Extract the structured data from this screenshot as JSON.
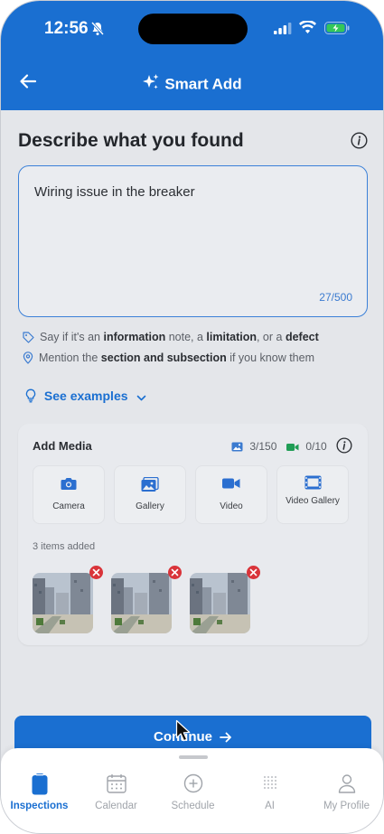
{
  "status": {
    "time": "12:56"
  },
  "nav": {
    "title": "Smart Add"
  },
  "main": {
    "heading": "Describe what you found",
    "description": {
      "value": "Wiring issue in the breaker",
      "counter": "27/500"
    },
    "hints": [
      {
        "icon": "tag-icon",
        "pre": "Say if it's an ",
        "b1": "information",
        "m1": " note, a ",
        "b2": "limitation",
        "m2": ", or a ",
        "b3": "defect"
      },
      {
        "icon": "location-pin-icon",
        "pre": "Mention the ",
        "b1": "section and subsection",
        "post": " if you know them"
      }
    ],
    "examples_label": "See examples"
  },
  "media": {
    "title": "Add Media",
    "photo_count": "3/150",
    "video_count": "0/10",
    "buttons": [
      {
        "label": "Camera",
        "icon": "camera-icon"
      },
      {
        "label": "Gallery",
        "icon": "gallery-icon"
      },
      {
        "label": "Video",
        "icon": "video-icon"
      },
      {
        "label": "Video Gallery",
        "icon": "video-gallery-icon"
      }
    ],
    "items_added": "3 items added",
    "thumbnails": 3
  },
  "continue_label": "Continue",
  "tabs": [
    {
      "label": "Inspections",
      "active": true
    },
    {
      "label": "Calendar",
      "active": false
    },
    {
      "label": "Schedule",
      "active": false
    },
    {
      "label": "AI",
      "active": false
    },
    {
      "label": "My Profile",
      "active": false
    }
  ],
  "colors": {
    "primary": "#1a6fd1",
    "danger": "#d9343a",
    "video_green": "#1f9d55"
  }
}
